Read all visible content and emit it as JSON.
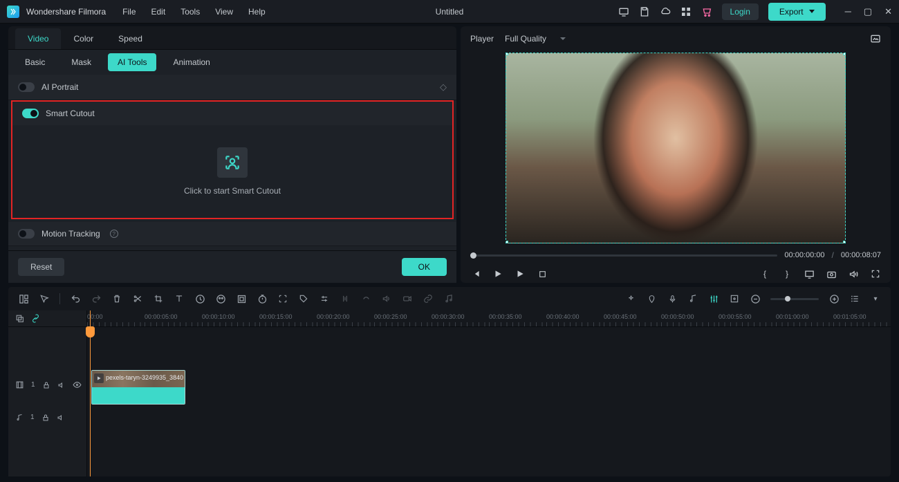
{
  "app_name": "Wondershare Filmora",
  "menu": [
    "File",
    "Edit",
    "Tools",
    "View",
    "Help"
  ],
  "project_title": "Untitled",
  "login_label": "Login",
  "export_label": "Export",
  "tabs": {
    "top": [
      "Video",
      "Color",
      "Speed"
    ],
    "sub": [
      "Basic",
      "Mask",
      "AI Tools",
      "Animation"
    ]
  },
  "sections": {
    "ai_portrait": "AI Portrait",
    "smart_cutout": "Smart Cutout",
    "smart_cutout_cta": "Click to start Smart Cutout",
    "motion_tracking": "Motion Tracking"
  },
  "reset_label": "Reset",
  "ok_label": "OK",
  "player": {
    "label": "Player",
    "quality": "Full Quality",
    "time_current": "00:00:00:00",
    "time_total": "00:00:08:07"
  },
  "ruler": [
    "00:00",
    "00:00:05:00",
    "00:00:10:00",
    "00:00:15:00",
    "00:00:20:00",
    "00:00:25:00",
    "00:00:30:00",
    "00:00:35:00",
    "00:00:40:00",
    "00:00:45:00",
    "00:00:50:00",
    "00:00:55:00",
    "00:01:00:00",
    "00:01:05:00"
  ],
  "clip_name": "pexels-taryn-3249935_3840",
  "track_video_num": "1",
  "track_audio_num": "1"
}
